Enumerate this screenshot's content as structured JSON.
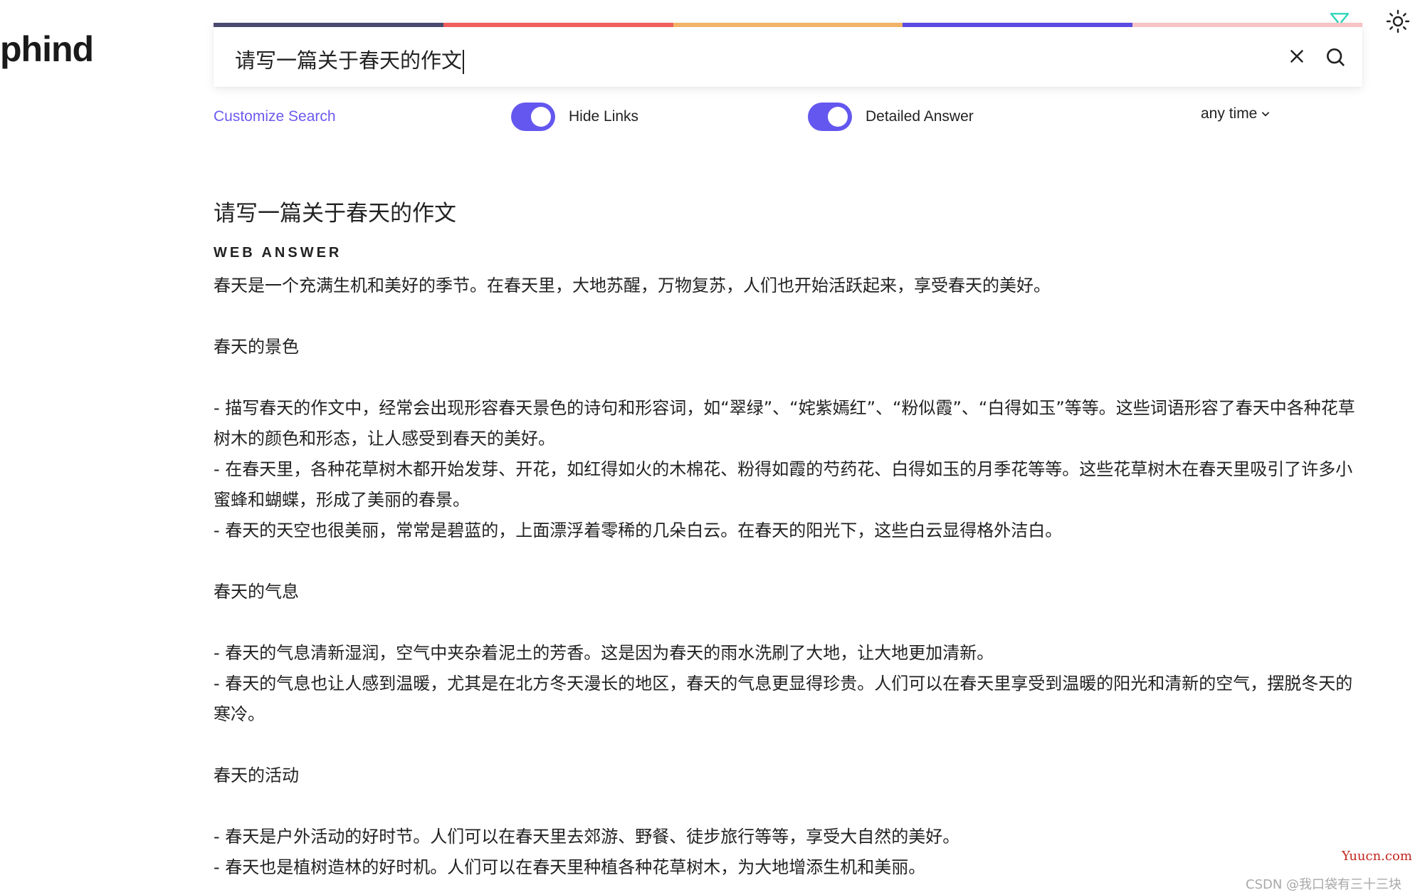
{
  "brand": {
    "logo_text": "phind"
  },
  "search": {
    "value": "请写一篇关于春天的作文",
    "rainbow_colors": [
      "#4a4a6e",
      "#ef5f5b",
      "#f2b366",
      "#5b4be0",
      "#f7c3c5"
    ]
  },
  "options": {
    "customize_label": "Customize Search",
    "hide_links_label": "Hide Links",
    "hide_links_on": true,
    "detailed_answer_label": "Detailed Answer",
    "detailed_answer_on": true,
    "time_filter": "any time"
  },
  "result": {
    "query": "请写一篇关于春天的作文",
    "section_label": "WEB ANSWER",
    "paragraphs": [
      "春天是一个充满生机和美好的季节。在春天里，大地苏醒，万物复苏，人们也开始活跃起来，享受春天的美好。",
      "",
      "春天的景色",
      "",
      "- 描写春天的作文中，经常会出现形容春天景色的诗句和形容词，如“翠绿”、“姹紫嫣红”、“粉似霞”、“白得如玉”等等。这些词语形容了春天中各种花草树木的颜色和形态，让人感受到春天的美好。",
      "- 在春天里，各种花草树木都开始发芽、开花，如红得如火的木棉花、粉得如霞的芍药花、白得如玉的月季花等等。这些花草树木在春天里吸引了许多小蜜蜂和蝴蝶，形成了美丽的春景。",
      "- 春天的天空也很美丽，常常是碧蓝的，上面漂浮着零稀的几朵白云。在春天的阳光下，这些白云显得格外洁白。",
      "",
      "春天的气息",
      "",
      "- 春天的气息清新湿润，空气中夹杂着泥土的芳香。这是因为春天的雨水洗刷了大地，让大地更加清新。",
      "- 春天的气息也让人感到温暖，尤其是在北方冬天漫长的地区，春天的气息更显得珍贵。人们可以在春天里享受到温暖的阳光和清新的空气，摆脱冬天的寒冷。",
      "",
      "春天的活动",
      "",
      "- 春天是户外活动的好时节。人们可以在春天里去郊游、野餐、徒步旅行等等，享受大自然的美好。",
      "- 春天也是植树造林的好时机。人们可以在春天里种植各种花草树木，为大地增添生机和美丽。"
    ]
  },
  "watermarks": {
    "site": "Yuucn.com",
    "csdn": "CSDN @我口袋有三十三块"
  },
  "icons": {
    "filter": "filter-icon",
    "theme": "sun-icon",
    "clear": "close-icon",
    "search": "search-icon",
    "dropdown": "chevron-down-icon"
  },
  "colors": {
    "accent": "#6457ef",
    "filter_icon": "#2fd6b8",
    "link": "#6a5bf0"
  }
}
